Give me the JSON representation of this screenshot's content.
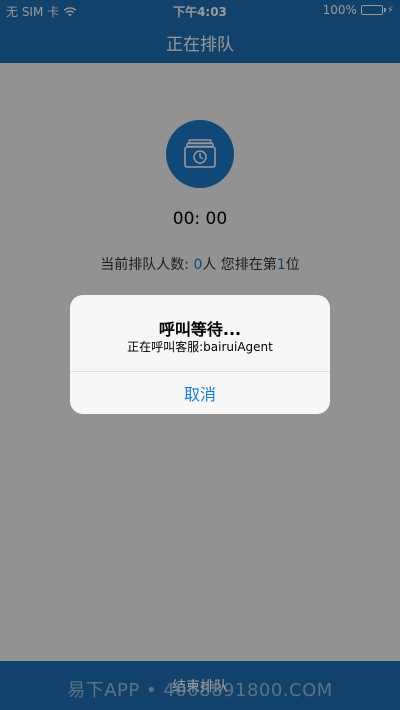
{
  "status_bar": {
    "carrier": "无 SIM 卡",
    "time": "下午4:03",
    "battery": "100%"
  },
  "nav": {
    "title": "正在排队"
  },
  "main": {
    "timer": "00: 00",
    "queue_prefix": "当前排队人数: ",
    "queue_count": "0",
    "queue_mid": "人 您排在第",
    "queue_position": "1",
    "queue_suffix": "位"
  },
  "bottom_bar": {
    "label": "结束排队"
  },
  "watermark": "易下APP • 4008891800.COM",
  "alert": {
    "title": "呼叫等待...",
    "message": "正在呼叫客服:bairuiAgent",
    "cancel_label": "取消"
  },
  "colors": {
    "header_blue": "#1c6fb3",
    "accent_blue": "#1c78c8",
    "battery_green": "#4cd964"
  }
}
